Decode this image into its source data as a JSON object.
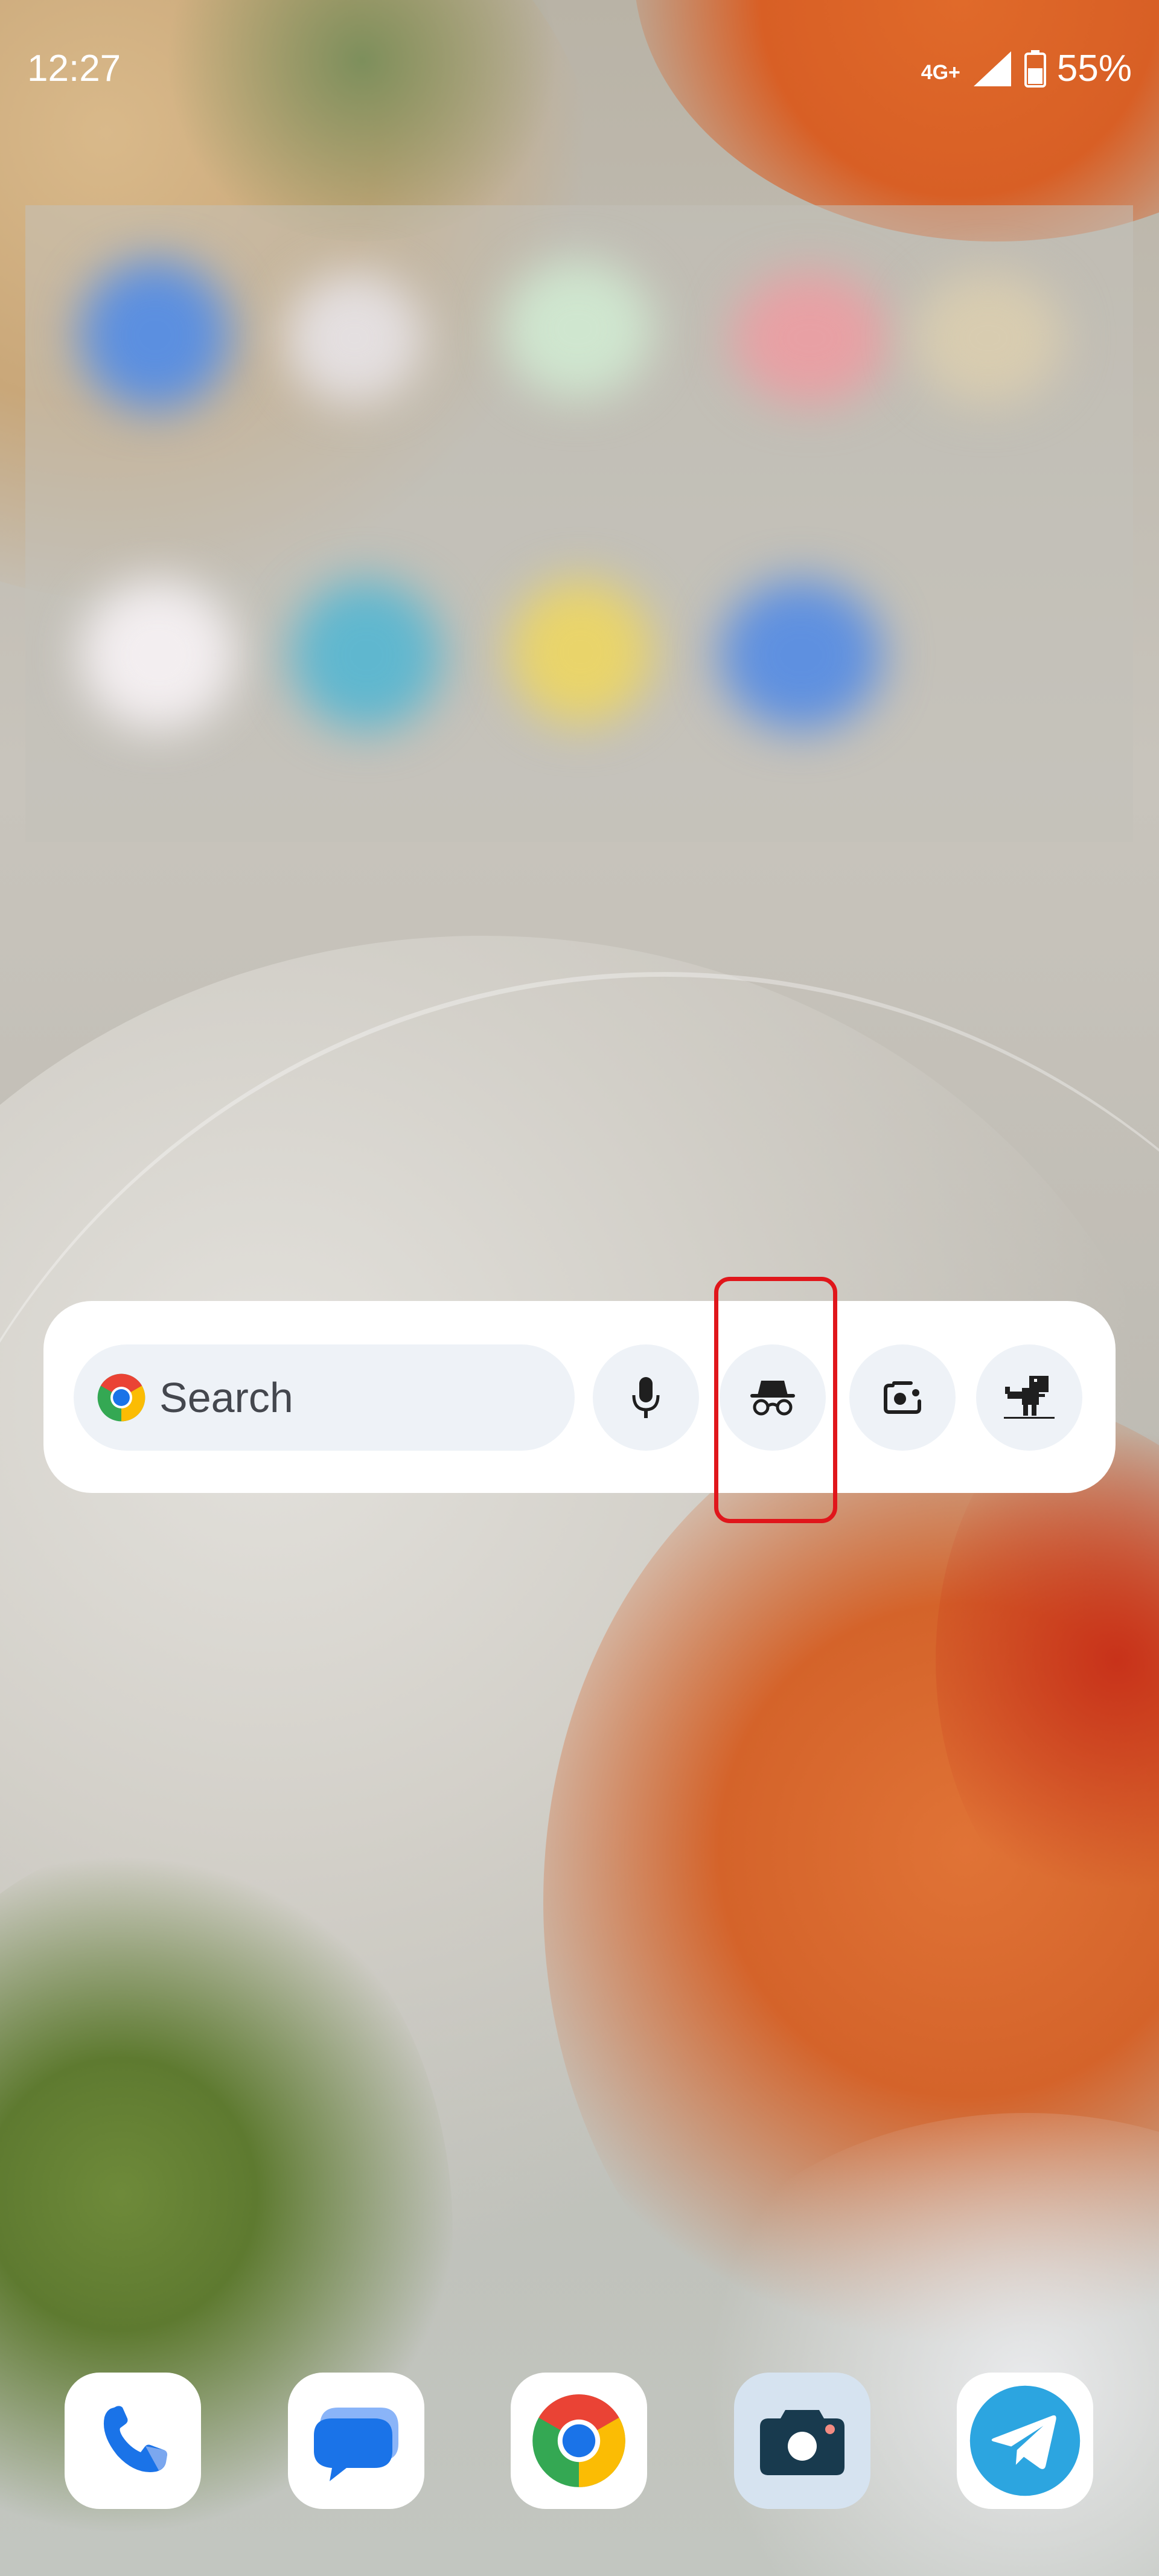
{
  "status_bar": {
    "time": "12:27",
    "network": "4G+",
    "battery": "55%"
  },
  "search_widget": {
    "search_label": "Search",
    "buttons": [
      {
        "name": "voice-search",
        "icon": "microphone-icon"
      },
      {
        "name": "incognito",
        "icon": "incognito-icon"
      },
      {
        "name": "lens",
        "icon": "camera-lens-icon"
      },
      {
        "name": "dino-game",
        "icon": "dinosaur-icon"
      }
    ]
  },
  "dock": [
    {
      "app": "phone",
      "icon": "phone-icon"
    },
    {
      "app": "messages",
      "icon": "messages-icon"
    },
    {
      "app": "chrome",
      "icon": "chrome-icon"
    },
    {
      "app": "camera",
      "icon": "camera-icon"
    },
    {
      "app": "telegram",
      "icon": "telegram-icon"
    }
  ],
  "colors": {
    "highlight": "#e0161b",
    "search_pill": "#eef2f7",
    "chrome_red": "#ea4335",
    "chrome_yellow": "#fbbc04",
    "chrome_green": "#34a853",
    "chrome_blue": "#1a73e8",
    "telegram_blue": "#2ca5e0"
  }
}
